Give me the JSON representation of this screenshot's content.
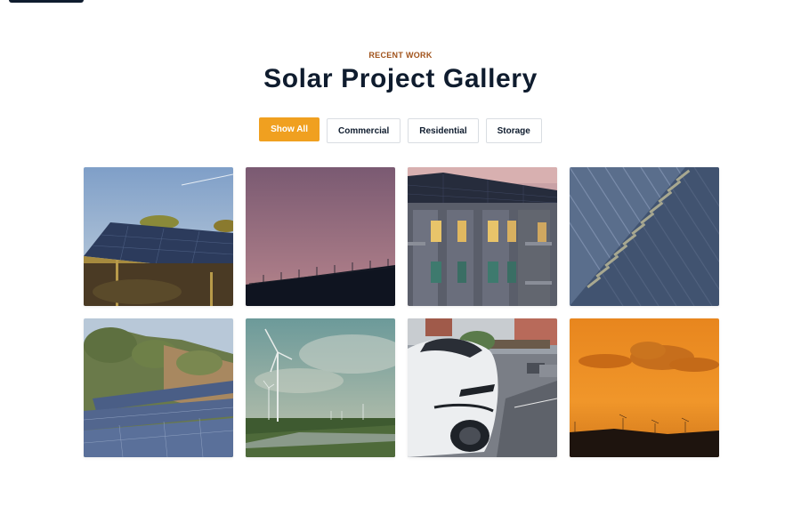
{
  "header": {
    "eyebrow": "RECENT WORK",
    "title": "Solar Project Gallery"
  },
  "filters": [
    {
      "label": "Show All",
      "active": true
    },
    {
      "label": "Commercial",
      "active": false
    },
    {
      "label": "Residential",
      "active": false
    },
    {
      "label": "Storage",
      "active": false
    }
  ],
  "colors": {
    "accent": "#f0a020",
    "heading": "#0f1c2e",
    "eyebrow": "#a0521a"
  }
}
